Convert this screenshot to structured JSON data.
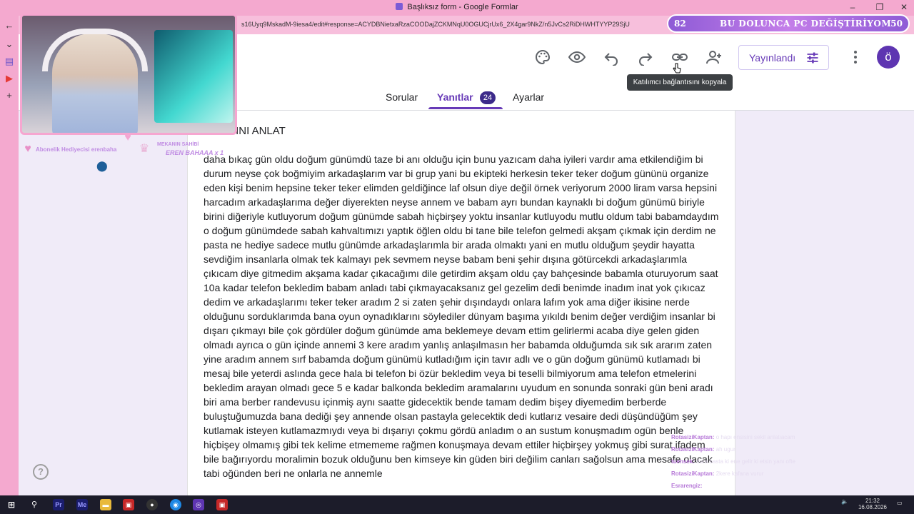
{
  "window": {
    "title": "Başlıksız form - Google Formlar"
  },
  "browser": {
    "url": "s16Uyq9MskadM-9iesa4/edit#response=ACYDBNietxaRzaCOODajZCKMNqU0OGUCjrUx6_2X4gar9NkZ/n5JvCs2RiDHWHTYYP29SjU"
  },
  "stream_banner": {
    "left": "82",
    "text": "BU DOLUNCA PC DEĞİŞTİRİYOM",
    "right": "50"
  },
  "header": {
    "publish_label": "Yayınlandı",
    "avatar_letter": "ö",
    "tooltip": "Katılımcı bağlantısını kopyala"
  },
  "tabs": {
    "questions": "Sorular",
    "responses": "Yanıtlar",
    "responses_count": "24",
    "settings": "Ayarlar"
  },
  "question": {
    "title": "ST ANINI ANLAT",
    "answer": "daha bıkaç gün oldu doğum günümdü taze bi anı olduğu için bunu yazıcam daha iyileri vardır ama etkilendiğim bi durum neyse çok boğmiyim arkadaşlarım var bi grup yani bu ekipteki herkesin teker teker doğum gününü organize eden kişi benim hepsine teker teker elimden geldiğince laf olsun diye değil örnek veriyorum  2000 liram varsa hepsini harcadım arkadaşlarıma değer diyerekten neyse annem ve babam ayrı bundan kaynaklı bi doğum günümü biriyle birini diğeriyle kutluyorum doğum günümde sabah hiçbirşey yoktu insanlar kutluyodu mutlu oldum tabi babamdaydım o doğum günümdede sabah kahvaltımızı yaptık öğlen oldu bi tane bile telefon gelmedi akşam çıkmak için derdim ne pasta ne hediye sadece mutlu günümde arkadaşlarımla bir arada olmaktı yani en mutlu olduğum şeydir hayatta sevdiğim insanlarla olmak tek kalmayı pek sevmem neyse babam beni şehir dışına götürcekdi arkadaşlarımla çıkıcam diye gitmedim akşama kadar çıkacağımı dile getirdim akşam oldu çay bahçesinde babamla oturuyorum saat 10a kadar telefon bekledim babam anladı tabi çıkmayacaksanız gel gezelim dedi benimde inadım inat yok çıkıcaz dedim ve arkadaşlarımı teker teker aradım 2 si zaten şehir dışındaydı onlara lafım yok ama diğer ikisine nerde olduğunu sorduklarımda bana oyun oynadıklarını söylediler dünyam başıma yıkıldı benim değer verdiğim insanlar bi dışarı çıkmayı bile çok gördüler doğum günümde ama beklemeye devam ettim gelirlermi acaba diye gelen giden olmadı ayrıca o gün içinde annemi 3 kere aradım yanlış anlaşılmasın her babamda olduğumda sık sık ararım zaten yine aradım annem sırf babamda doğum günümü kutladığım için tavır adlı ve o gün doğum günümü kutlamadı bi mesaj bile yeterdi aslında gece hala bi telefon bi özür bekledim veya bi teselli bilmiyorum ama telefon etmelerini bekledim arayan olmadı gece 5 e kadar balkonda bekledim aramalarını uyudum en sonunda sonraki gün beni aradı biri ama berber randevusu içinmiş aynı saatte gidecektik bende tamam dedim bişey diyemedim berberde buluştuğumuzda bana dediği şey annende olsan pastayla gelecektik dedi kutlarız vesaire dedi düşündüğüm şey kutlamak isteyen kutlamazmıydı veya bi dışarıyı çokmu gördü anladım o an sustum konuşmadım ogün benle hiçbişey olmamış gibi tek kelime etmememe rağmen konuşmaya devam ettiler hiçbirşey yokmuş gibi surat ifadem bile bağırıyordu moralimin bozuk olduğunu ben kimseye kin güden biri değilim canları sağolsun ama mesafe olacak tabi oğünden beri ne onlarla ne annemle"
  },
  "overlay": {
    "sub_caption": "Abonelik Hediyecisi erenbaha",
    "owner_caption": "MEKANIN SAHİBİ",
    "owner_name": "EREN BAHAAA x 1"
  },
  "chat": [
    {
      "user": "RotasiziKaptan:",
      "msg": "o hapı ensisini sekil anlatıacam"
    },
    {
      "user": "RotasiziKaptan:",
      "msg": "ah ugur"
    },
    {
      "user": "tuensek:",
      "msg": "dura basta ki ene gelir ki etsin yanı ofte"
    },
    {
      "user": "RotasiziKaptan:",
      "msg": "2kere kafana vurur"
    },
    {
      "user": "Esrarengiz:",
      "msg": ""
    }
  ],
  "taskbar": {
    "time": "21:32",
    "date": "16.08.2026"
  }
}
